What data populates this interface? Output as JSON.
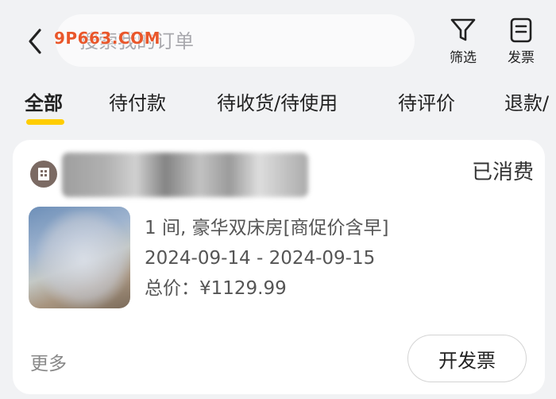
{
  "header": {
    "search_placeholder": "搜索我的订单",
    "watermark": "9P663.COM",
    "filter_label": "筛选",
    "invoice_label": "发票"
  },
  "tabs": [
    {
      "label": "全部",
      "active": true
    },
    {
      "label": "待付款",
      "active": false
    },
    {
      "label": "待收货/待使用",
      "active": false
    },
    {
      "label": "待评价",
      "active": false
    },
    {
      "label": "退款/",
      "active": false
    }
  ],
  "order": {
    "status": "已消费",
    "room": "1 间, 豪华双床房[商促价含早]",
    "dates": "2024-09-14 - 2024-09-15",
    "total": "总价：¥1129.99",
    "more_label": "更多",
    "invoice_button_label": "开发票"
  },
  "colors": {
    "accent": "#ffcd00",
    "background": "#f1f2f4",
    "watermark": "#e9572b"
  }
}
